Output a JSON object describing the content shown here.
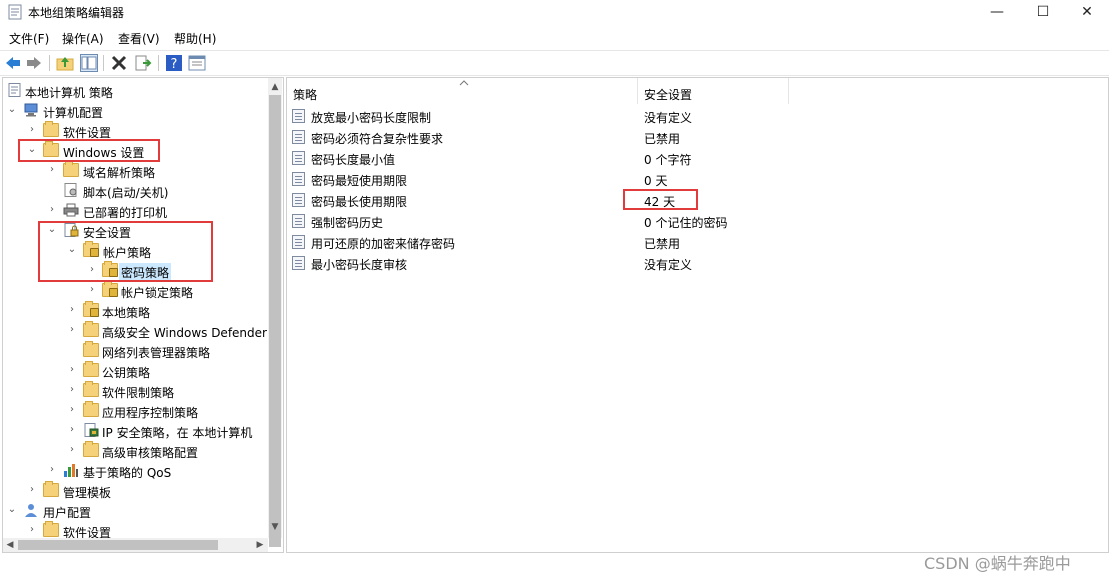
{
  "window": {
    "title": "本地组策略编辑器",
    "controls": {
      "minimize": "—",
      "maximize": "☐",
      "close": "✕"
    }
  },
  "menu": [
    "文件(F)",
    "操作(A)",
    "查看(V)",
    "帮助(H)"
  ],
  "toolbar": {
    "buttons": [
      "back-icon",
      "forward-icon",
      "up-folder-icon",
      "show-hide-tree-icon",
      "delete-icon",
      "export-icon",
      "help-icon",
      "properties-icon"
    ]
  },
  "tree": {
    "root": "本地计算机 策略",
    "computer_config": "计算机配置",
    "software_settings": "软件设置",
    "windows_settings": "Windows 设置",
    "dns_policy": "域名解析策略",
    "scripts": "脚本(启动/关机)",
    "printers": "已部署的打印机",
    "security_settings": "安全设置",
    "account_policies": "帐户策略",
    "password_policy": "密码策略",
    "lockout_policy": "帐户锁定策略",
    "local_policies": "本地策略",
    "firewall": "高级安全 Windows Defender",
    "network_list": "网络列表管理器策略",
    "public_key": "公钥策略",
    "software_restriction": "软件限制策略",
    "app_control": "应用程序控制策略",
    "ipsec": "IP 安全策略，在 本地计算机",
    "audit_policy": "高级审核策略配置",
    "qos": "基于策略的 QoS",
    "admin_templates": "管理模板",
    "user_config": "用户配置",
    "user_software_settings": "软件设置"
  },
  "columns": {
    "policy": "策略",
    "setting": "安全设置"
  },
  "rows": [
    {
      "name": "放宽最小密码长度限制",
      "value": "没有定义"
    },
    {
      "name": "密码必须符合复杂性要求",
      "value": "已禁用"
    },
    {
      "name": "密码长度最小值",
      "value": "0 个字符"
    },
    {
      "name": "密码最短使用期限",
      "value": "0 天"
    },
    {
      "name": "密码最长使用期限",
      "value": "42 天"
    },
    {
      "name": "强制密码历史",
      "value": "0 个记住的密码"
    },
    {
      "name": "用可还原的加密来储存密码",
      "value": "已禁用"
    },
    {
      "name": "最小密码长度审核",
      "value": "没有定义"
    }
  ],
  "watermark": "CSDN @蜗牛奔跑中",
  "colors": {
    "highlight": "#e23b3b",
    "selection": "#cce8ff",
    "folder": "#f5d27a"
  }
}
